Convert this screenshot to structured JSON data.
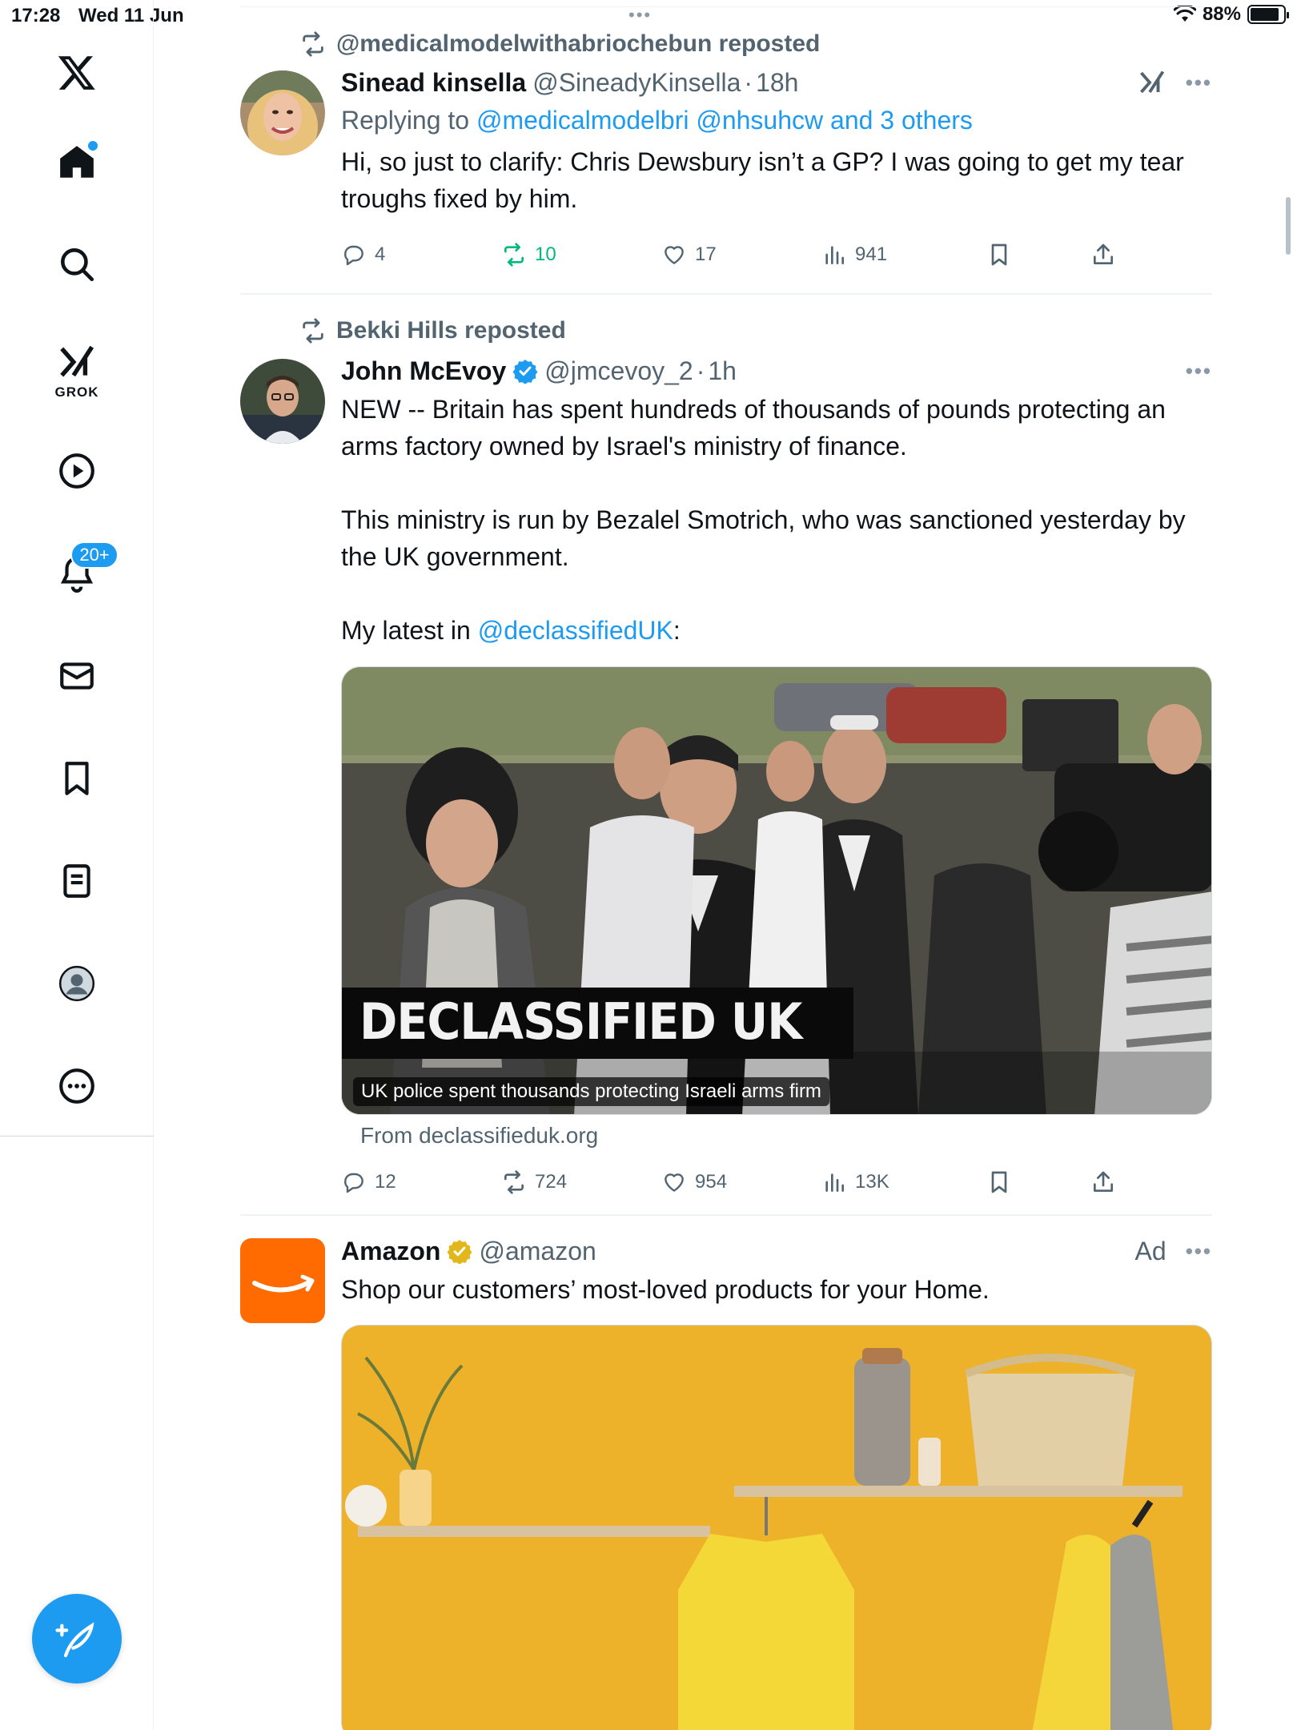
{
  "status_bar": {
    "time": "17:28",
    "date": "Wed 11 Jun",
    "battery": "88%",
    "battery_level": 0.88
  },
  "sidebar": {
    "grok_label": "GROK",
    "notifications_badge": "20+",
    "icons": [
      "x-logo-icon",
      "home-icon",
      "search-icon",
      "grok-icon",
      "video-icon",
      "bell-icon",
      "mail-icon",
      "bookmark-icon",
      "lists-icon",
      "profile-icon",
      "more-circle-icon",
      "compose-icon"
    ]
  },
  "colors": {
    "accent": "#1d9bf0",
    "repost_active": "#00ba7c",
    "secondary_text": "#536471",
    "amazon_orange": "#ff6b00"
  },
  "posts": [
    {
      "reposted_by": "@medicalmodelwithabriochebun reposted",
      "name": "Sinead kinsella",
      "handle": "@SineadyKinsella",
      "separator": "·",
      "time": "18h",
      "replying_prefix": "Replying to",
      "replying_to": "@medicalmodelbri @nhsuhcw and 3 others",
      "text": "Hi, so just to clarify: Chris Dewsbury isn’t a GP? I was going to get my tear troughs fixed by him.",
      "stats": {
        "replies": "4",
        "reposts": "10",
        "likes": "17",
        "views": "941"
      }
    },
    {
      "reposted_by": "Bekki Hills reposted",
      "name": "John McEvoy",
      "handle": "@jmcevoy_2",
      "separator": "·",
      "time": "1h",
      "text_p1": "NEW -- Britain has spent hundreds of thousands of pounds protecting an arms factory owned by Israel's ministry of finance.",
      "text_p2": "This ministry is run by Bezalel Smotrich, who was sanctioned yesterday by the UK government.",
      "text_p3_prefix": "My latest in ",
      "text_p3_link": "@declassifiedUK",
      "text_p3_suffix": ":",
      "card": {
        "banner_text": "DECLASSIFIED UK",
        "caption": "UK police spent thousands protecting Israeli arms firm",
        "source": "From declassifieduk.org"
      },
      "stats": {
        "replies": "12",
        "reposts": "724",
        "likes": "954",
        "views": "13K"
      }
    },
    {
      "name": "Amazon",
      "handle": "@amazon",
      "ad_label": "Ad",
      "text": "Shop our customers’ most-loved products for your Home."
    }
  ]
}
